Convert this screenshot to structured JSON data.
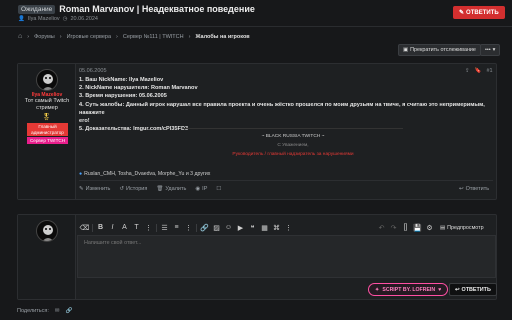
{
  "thread": {
    "prefix": "Ожидание",
    "title": "Roman Marvanov | Неадекватное поведение",
    "author": "Ilya Mazeliov",
    "date": "20.06.2024",
    "reply_label": "ОТВЕТИТЬ"
  },
  "breadcrumbs": [
    "Форумы",
    "Игровые сервера",
    "Сервер №111 | TWITCH",
    "Жалобы на игроков"
  ],
  "watch_label": "Прекратить отслеживание",
  "post": {
    "date": "05.06.2005",
    "number": "#1",
    "user": {
      "name": "Ilya Mazeliov",
      "title_line1": "Тот самый Twitch",
      "title_line2": "стример",
      "banner_role_line1": "Главный",
      "banner_role_line2": "администратор",
      "banner_server": "Сервер TWITCH"
    },
    "lines": [
      "1. Ваш NickName: Ilya Mazeliov",
      "2. NickName нарушителя: Roman Marvanov",
      "3. Время нарушения: 05.06.2005",
      "4. Суть жалобы: Данный игрок нарушал все правила проекта и очень жёстко прошелся по моим друзьям на твиче, я считаю это непримеримым, накажите",
      "его!",
      "5. Доказательства: Imgur.com/cPl35FD3"
    ],
    "sig_line1": "~ BLACK RUSSIA TWITCH ~",
    "sig_line2": "С Уважением,",
    "sig_line3": "Руководитель / главный надзиратель за нарушениями",
    "reactions": "Ruslan_CMH, Tosha_Dvaedva, Morphe_Yu и 3 других",
    "actions": {
      "edit": "Изменить",
      "history": "История",
      "delete": "Удалить",
      "ip": "IP",
      "reply": "Ответить"
    }
  },
  "editor": {
    "placeholder": "Напишите свой ответ...",
    "preview_label": "Предпросмотр",
    "script_badge": "SCRIPT BY. LOFREIN",
    "submit_label": "ОТВЕТИТЬ"
  },
  "share_label": "Поделиться:",
  "colors": {
    "accent_red": "#d32f2f",
    "role_red": "#e53935",
    "role_pink": "#e91e8c",
    "script_pink": "#ff4fa3",
    "username_red": "#ff3b3b"
  }
}
